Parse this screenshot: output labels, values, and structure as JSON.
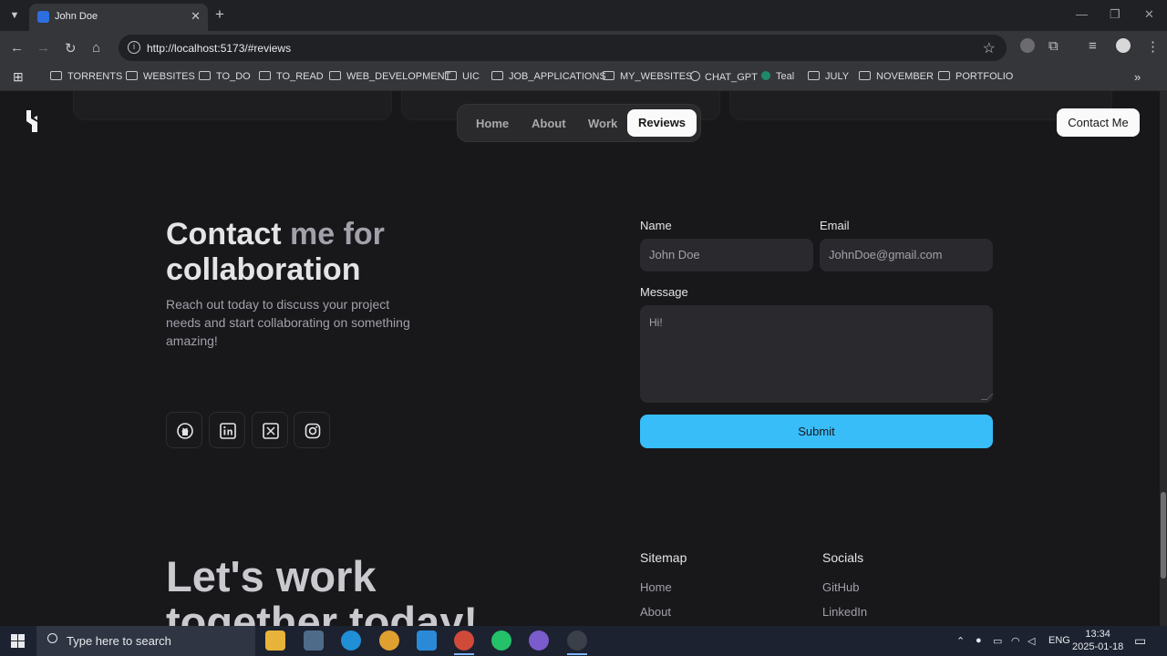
{
  "browser": {
    "tab_title": "John Doe",
    "url": "http://localhost:5173/#reviews",
    "bookmarks": [
      "TORRENTS",
      "WEBSITES",
      "TO_DO",
      "TO_READ",
      "WEB_DEVELOPMENT",
      "UIC",
      "JOB_APPLICATIONS",
      "MY_WEBSITES",
      "CHAT_GPT",
      "Teal",
      "JULY",
      "NOVEMBER",
      "PORTFOLIO"
    ]
  },
  "header": {
    "nav": [
      "Home",
      "About",
      "Work",
      "Reviews"
    ],
    "active_nav": "Reviews",
    "contact_button": "Contact Me"
  },
  "contact": {
    "title_part1": "Contact ",
    "title_part2": "me for",
    "title_part3": "collaboration",
    "lead": "Reach out today to discuss your project needs and start collaborating on something amazing!",
    "socials": [
      "github-icon",
      "linkedin-icon",
      "x-icon",
      "instagram-icon"
    ],
    "form": {
      "name_label": "Name",
      "name_placeholder": "John Doe",
      "email_label": "Email",
      "email_placeholder": "JohnDoe@gmail.com",
      "message_label": "Message",
      "message_placeholder": "Hi!",
      "submit": "Submit"
    }
  },
  "footer": {
    "headline_line1": "Let's work",
    "headline_line2": "together today!",
    "sitemap_title": "Sitemap",
    "sitemap": [
      "Home",
      "About"
    ],
    "socials_title": "Socials",
    "socials": [
      "GitHub",
      "LinkedIn"
    ]
  },
  "taskbar": {
    "search_placeholder": "Type here to search",
    "language": "ENG",
    "time": "13:34",
    "date": "2025-01-18"
  }
}
